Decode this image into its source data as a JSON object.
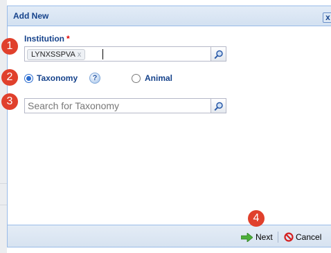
{
  "dialog": {
    "title": "Add New",
    "close_glyph": "x"
  },
  "institution": {
    "label": "Institution",
    "required_marker": "*",
    "tag_value": "LYNXSSPVA",
    "tag_remove": "x"
  },
  "radios": {
    "taxonomy_label": "Taxonomy",
    "taxonomy_checked": true,
    "animal_label": "Animal",
    "animal_checked": false,
    "help_icon_glyph": "?"
  },
  "taxonomy_search": {
    "placeholder": "Search for Taxonomy",
    "value": ""
  },
  "footer": {
    "next_label": "Next",
    "cancel_label": "Cancel"
  },
  "callouts": [
    "1",
    "2",
    "3",
    "4"
  ],
  "colors": {
    "accent": "#15428b",
    "required": "#e00000",
    "callout": "#e0402c",
    "border": "#99bbe8"
  }
}
